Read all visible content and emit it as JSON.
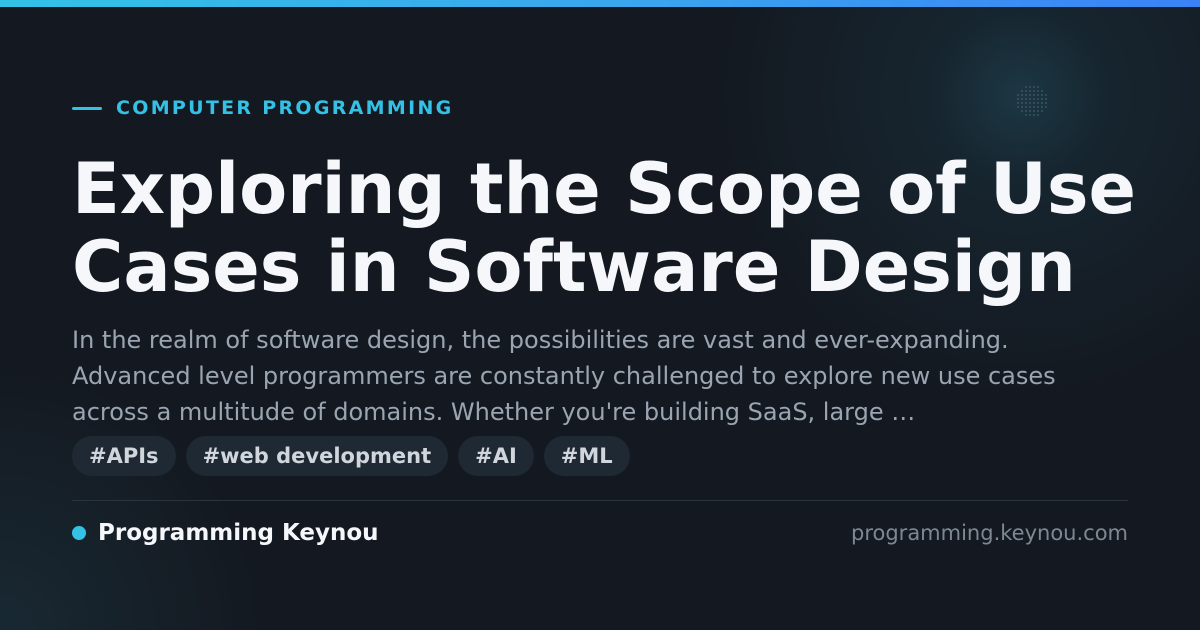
{
  "colors": {
    "accent": "#33c2e6",
    "accent_end": "#3b82f6",
    "background": "#141921",
    "title": "#f5f7fa",
    "body_text": "#9aa5b1",
    "tag_bg": "#1f2933"
  },
  "category": "COMPUTER PROGRAMMING",
  "title": "Exploring the Scope of Use Cases in Software Design",
  "description": "In the realm of software design, the possibilities are vast and ever-expanding. Advanced level programmers are constantly challenged to explore new use cases across a multitude of domains. Whether you're building SaaS, large …",
  "tags": [
    "#APIs",
    "#web development",
    "#AI",
    "#ML"
  ],
  "footer": {
    "brand_name": "Programming Keynou",
    "domain": "programming.keynou.com"
  }
}
